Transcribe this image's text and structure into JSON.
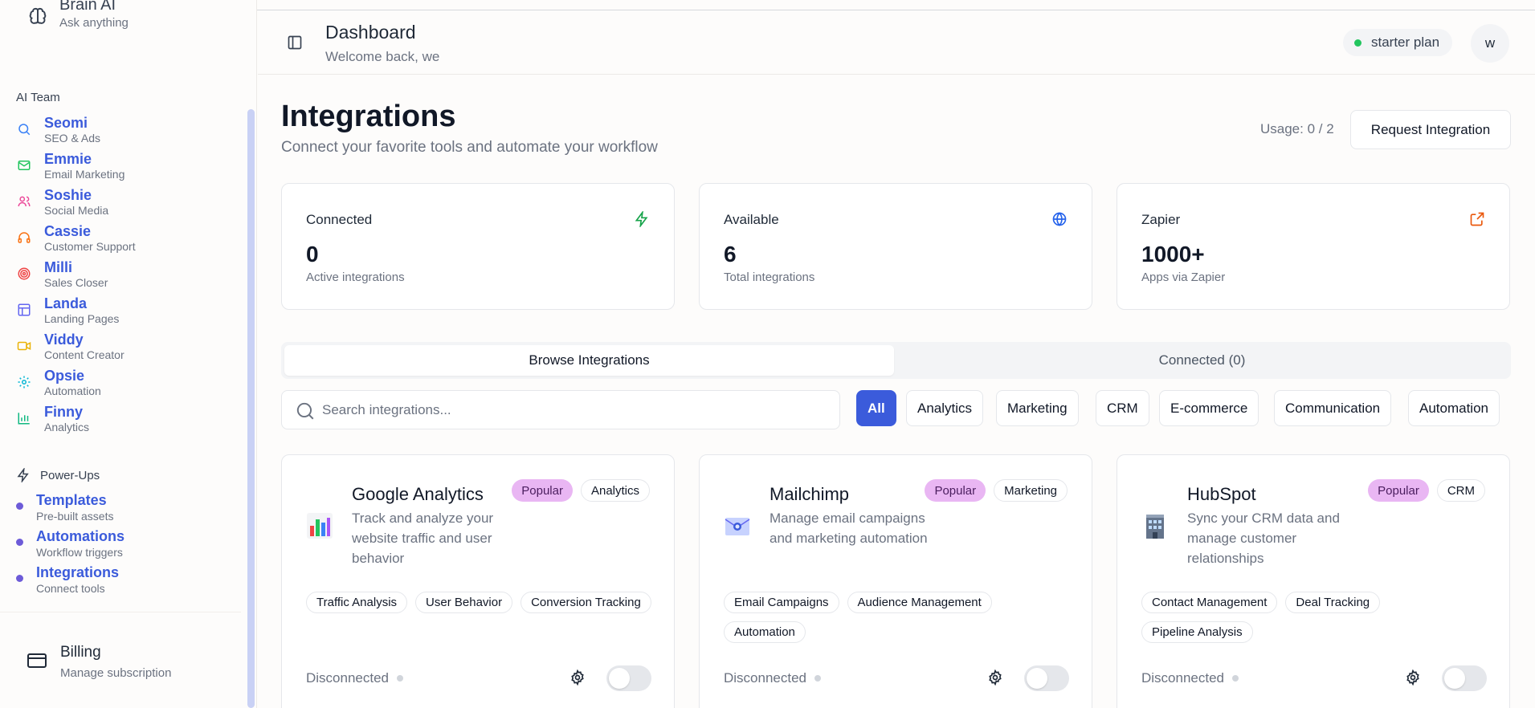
{
  "brand": {
    "name": "Brain AI",
    "subtitle": "Ask anything"
  },
  "sidebar": {
    "team_label": "AI Team",
    "agents": [
      {
        "name": "Seomi",
        "desc": "SEO & Ads",
        "icon": "search-icon",
        "color": "#3b82f6"
      },
      {
        "name": "Emmie",
        "desc": "Email Marketing",
        "icon": "mail-icon",
        "color": "#22c55e"
      },
      {
        "name": "Soshie",
        "desc": "Social Media",
        "icon": "users-icon",
        "color": "#ec4899"
      },
      {
        "name": "Cassie",
        "desc": "Customer Support",
        "icon": "headphones-icon",
        "color": "#f97316"
      },
      {
        "name": "Milli",
        "desc": "Sales Closer",
        "icon": "target-icon",
        "color": "#ef4444"
      },
      {
        "name": "Landa",
        "desc": "Landing Pages",
        "icon": "layout-icon",
        "color": "#6366f1"
      },
      {
        "name": "Viddy",
        "desc": "Content Creator",
        "icon": "video-icon",
        "color": "#eab308"
      },
      {
        "name": "Opsie",
        "desc": "Automation",
        "icon": "gear-icon",
        "color": "#06b6d4"
      },
      {
        "name": "Finny",
        "desc": "Analytics",
        "icon": "bar-chart-icon",
        "color": "#10b981"
      }
    ],
    "powerups_label": "Power-Ups",
    "powerups": [
      {
        "name": "Templates",
        "desc": "Pre-built assets"
      },
      {
        "name": "Automations",
        "desc": "Workflow triggers"
      },
      {
        "name": "Integrations",
        "desc": "Connect tools"
      }
    ],
    "billing": {
      "name": "Billing",
      "desc": "Manage subscription"
    }
  },
  "header": {
    "title": "Dashboard",
    "subtitle": "Welcome back, we",
    "plan": "starter plan",
    "avatar": "w"
  },
  "page": {
    "title": "Integrations",
    "subtitle": "Connect your favorite tools and automate your workflow",
    "usage": "Usage: 0 / 2",
    "request_button": "Request Integration"
  },
  "stats": [
    {
      "label": "Connected",
      "value": "0",
      "desc": "Active integrations",
      "icon": "zap-icon",
      "color": "#16a34a"
    },
    {
      "label": "Available",
      "value": "6",
      "desc": "Total integrations",
      "icon": "globe-icon",
      "color": "#2563eb"
    },
    {
      "label": "Zapier",
      "value": "1000+",
      "desc": "Apps via Zapier",
      "icon": "external-link-icon",
      "color": "#ea580c"
    }
  ],
  "tabs": {
    "browse": "Browse Integrations",
    "connected": "Connected (0)"
  },
  "search": {
    "placeholder": "Search integrations...",
    "value": ""
  },
  "filters": [
    "All",
    "Analytics",
    "Marketing",
    "CRM",
    "E-commerce",
    "Communication",
    "Automation"
  ],
  "cards": [
    {
      "name": "Google Analytics",
      "badge": "Popular",
      "category": "Analytics",
      "desc": "Track and analyze your website traffic and user behavior",
      "features": [
        "Traffic Analysis",
        "User Behavior",
        "Conversion Tracking"
      ],
      "status": "Disconnected",
      "logo": "bar-chart-logo-icon"
    },
    {
      "name": "Mailchimp",
      "badge": "Popular",
      "category": "Marketing",
      "desc": "Manage email campaigns and marketing automation",
      "features": [
        "Email Campaigns",
        "Audience Management",
        "Automation"
      ],
      "status": "Disconnected",
      "logo": "mail-logo-icon"
    },
    {
      "name": "HubSpot",
      "badge": "Popular",
      "category": "CRM",
      "desc": "Sync your CRM data and manage customer relationships",
      "features": [
        "Contact Management",
        "Deal Tracking",
        "Pipeline Analysis"
      ],
      "status": "Disconnected",
      "logo": "building-logo-icon"
    }
  ]
}
